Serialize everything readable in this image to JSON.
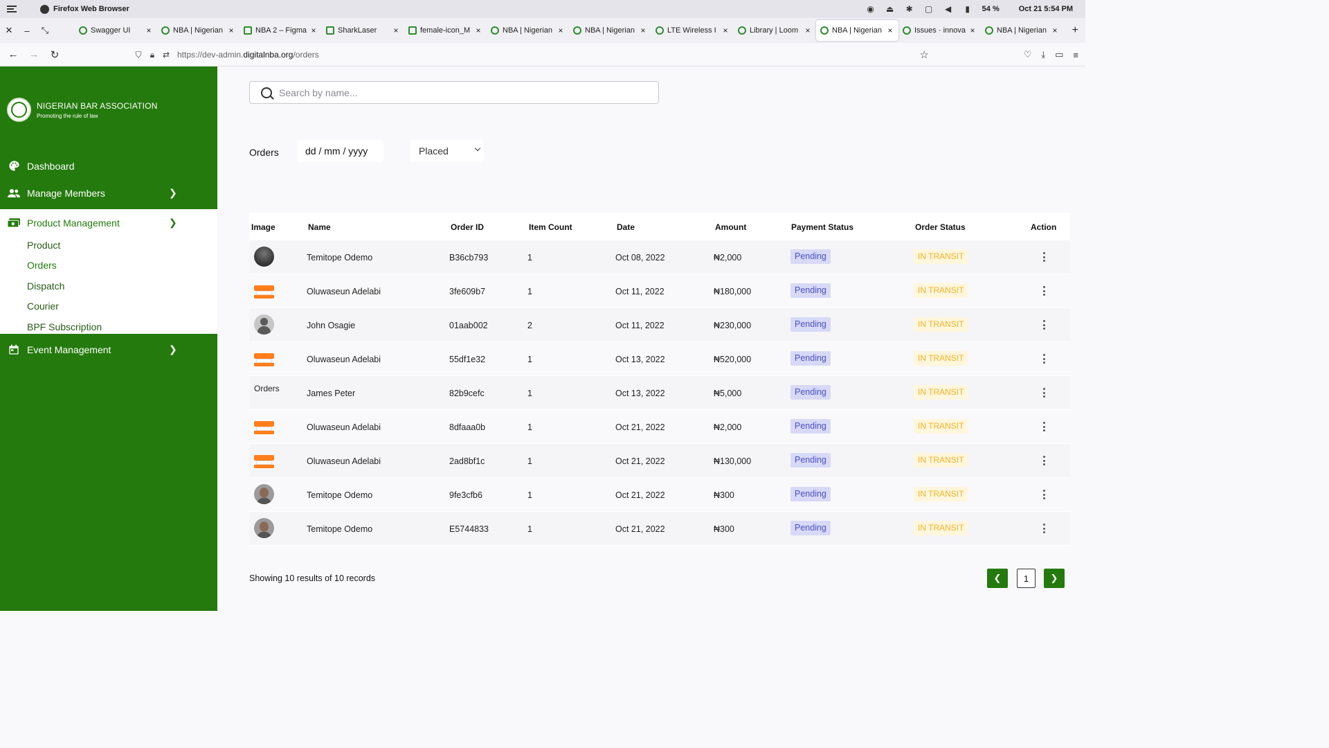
{
  "os": {
    "app_title": "Firefox Web Browser",
    "battery": "54 %",
    "clock": "Oct 21  5:54 PM"
  },
  "tabs": [
    {
      "label": "Swagger UI",
      "active": false
    },
    {
      "label": "NBA | Nigerian",
      "active": false
    },
    {
      "label": "NBA 2 – Figma",
      "active": false
    },
    {
      "label": "SharkLaser",
      "active": false
    },
    {
      "label": "female-icon_M",
      "active": false
    },
    {
      "label": "NBA | Nigerian",
      "active": false
    },
    {
      "label": "NBA | Nigerian",
      "active": false
    },
    {
      "label": "LTE Wireless I",
      "active": false
    },
    {
      "label": "Library | Loom",
      "active": false
    },
    {
      "label": "NBA | Nigerian",
      "active": true
    },
    {
      "label": "Issues · innova",
      "active": false
    },
    {
      "label": "NBA | Nigerian",
      "active": false
    }
  ],
  "url": {
    "prefix": "https://dev-admin.",
    "domain": "digitalnba.org",
    "path": "/orders"
  },
  "brand": {
    "name": "NIGERIAN BAR ASSOCIATION",
    "tagline": "Promoting the rule of law"
  },
  "nav": {
    "dashboard": "Dashboard",
    "manage_members": "Manage Members",
    "product_management": "Product Management",
    "event_management": "Event Management",
    "sub": {
      "product": "Product",
      "orders": "Orders",
      "dispatch": "Dispatch",
      "courier": "Courier",
      "bpf": "BPF Subscription"
    }
  },
  "search": {
    "placeholder": "Search by name..."
  },
  "filters": {
    "label": "Orders",
    "date_placeholder": "dd / mm / yyyy",
    "status_selected": "Placed"
  },
  "table": {
    "headers": {
      "image": "Image",
      "name": "Name",
      "order_id": "Order ID",
      "item_count": "Item Count",
      "date": "Date",
      "amount": "Amount",
      "payment_status": "Payment Status",
      "order_status": "Order Status",
      "action": "Action"
    },
    "rows": [
      {
        "image_alt": "",
        "name": "Temitope Odemo",
        "order_id": "B36cb793",
        "item_count": "1",
        "date": "Oct 08, 2022",
        "amount": "₦2,000",
        "payment_status": "Pending",
        "order_status": "IN TRANSIT"
      },
      {
        "image_alt": "",
        "name": "Oluwaseun Adelabi",
        "order_id": "3fe609b7",
        "item_count": "1",
        "date": "Oct 11, 2022",
        "amount": "₦180,000",
        "payment_status": "Pending",
        "order_status": "IN TRANSIT"
      },
      {
        "image_alt": "",
        "name": "John Osagie",
        "order_id": "01aab002",
        "item_count": "2",
        "date": "Oct 11, 2022",
        "amount": "₦230,000",
        "payment_status": "Pending",
        "order_status": "IN TRANSIT"
      },
      {
        "image_alt": "",
        "name": "Oluwaseun Adelabi",
        "order_id": "55df1e32",
        "item_count": "1",
        "date": "Oct 13, 2022",
        "amount": "₦520,000",
        "payment_status": "Pending",
        "order_status": "IN TRANSIT"
      },
      {
        "image_alt": "Orders",
        "name": "James Peter",
        "order_id": "82b9cefc",
        "item_count": "1",
        "date": "Oct 13, 2022",
        "amount": "₦5,000",
        "payment_status": "Pending",
        "order_status": "IN TRANSIT"
      },
      {
        "image_alt": "",
        "name": "Oluwaseun Adelabi",
        "order_id": "8dfaaa0b",
        "item_count": "1",
        "date": "Oct 21, 2022",
        "amount": "₦2,000",
        "payment_status": "Pending",
        "order_status": "IN TRANSIT"
      },
      {
        "image_alt": "",
        "name": "Oluwaseun Adelabi",
        "order_id": "2ad8bf1c",
        "item_count": "1",
        "date": "Oct 21, 2022",
        "amount": "₦130,000",
        "payment_status": "Pending",
        "order_status": "IN TRANSIT"
      },
      {
        "image_alt": "",
        "name": "Temitope Odemo",
        "order_id": "9fe3cfb6",
        "item_count": "1",
        "date": "Oct 21, 2022",
        "amount": "₦300",
        "payment_status": "Pending",
        "order_status": "IN TRANSIT"
      },
      {
        "image_alt": "",
        "name": "Temitope Odemo",
        "order_id": "E5744833",
        "item_count": "1",
        "date": "Oct 21, 2022",
        "amount": "₦300",
        "payment_status": "Pending",
        "order_status": "IN TRANSIT"
      }
    ]
  },
  "pagination": {
    "summary": "Showing 10 results of 10 records",
    "current_page": "1"
  },
  "colors": {
    "brand_green": "#247a0d",
    "pending_bg": "#d7d9f7",
    "pending_text": "#4a4fc4",
    "transit_bg": "#fff6dc",
    "transit_text": "#f0b429"
  }
}
